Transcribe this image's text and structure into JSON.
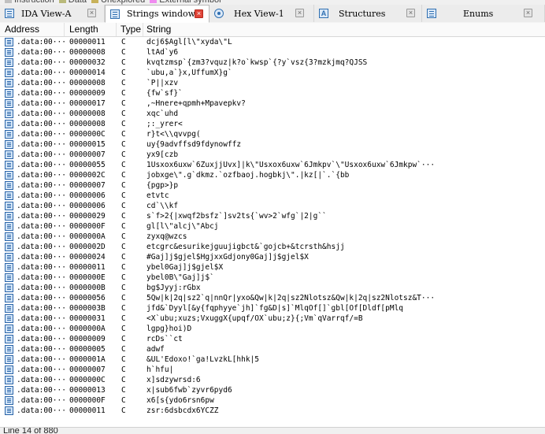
{
  "legend": [
    {
      "label": "Instruction",
      "color": "#c0c0c0"
    },
    {
      "label": "Data",
      "color": "#b9b97a"
    },
    {
      "label": "Unexplored",
      "color": "#c8b25a"
    },
    {
      "label": "External symbol",
      "color": "#f08cf0"
    }
  ],
  "tabs": [
    {
      "label": "IDA View-A",
      "icon": "disassembly-icon",
      "active": false
    },
    {
      "label": "Strings window",
      "icon": "strings-icon",
      "active": true
    },
    {
      "label": "Hex View-1",
      "icon": "hex-view-icon",
      "active": false
    },
    {
      "label": "Structures",
      "icon": "structures-icon",
      "active": false
    },
    {
      "label": "Enums",
      "icon": "enums-icon",
      "active": false
    }
  ],
  "columns": {
    "address": "Address",
    "length": "Length",
    "type": "Type",
    "string": "String"
  },
  "rows": [
    {
      "address": ".data:00···",
      "length": "00000011",
      "type": "C",
      "string": "dcj6$Agl[l\\\"xyda\\\"L"
    },
    {
      "address": ".data:00···",
      "length": "00000008",
      "type": "C",
      "string": "ltAd`y6"
    },
    {
      "address": ".data:00···",
      "length": "00000032",
      "type": "C",
      "string": "kvqtzmsp`{zm3?vquz|k?o`kwsp`{?y`vsz{3?mzkjmq?QJSS"
    },
    {
      "address": ".data:00···",
      "length": "00000014",
      "type": "C",
      "string": "`ubu,a`}x,UffumX}g`"
    },
    {
      "address": ".data:00···",
      "length": "00000008",
      "type": "C",
      "string": "`P||xzv"
    },
    {
      "address": ".data:00···",
      "length": "00000009",
      "type": "C",
      "string": "{fw`sf}`"
    },
    {
      "address": ".data:00···",
      "length": "00000017",
      "type": "C",
      "string": ",~Hnere+qpmh+Mpavepkv?"
    },
    {
      "address": ".data:00···",
      "length": "00000008",
      "type": "C",
      "string": "xqc`uhd"
    },
    {
      "address": ".data:00···",
      "length": "00000008",
      "type": "C",
      "string": ";:_yrer<"
    },
    {
      "address": ".data:00···",
      "length": "0000000C",
      "type": "C",
      "string": "r}t<\\\\qvvpg("
    },
    {
      "address": ".data:00···",
      "length": "00000015",
      "type": "C",
      "string": "uy{9advffsd9fdynowffz"
    },
    {
      "address": ".data:00···",
      "length": "00000007",
      "type": "C",
      "string": "yx9[czb"
    },
    {
      "address": ".data:00···",
      "length": "00000055",
      "type": "C",
      "string": "1Usxox6uxw`6ZuxjjUvx]|k\\\"Usxox6uxw`6Jmkpv`\\\"Usxox6uxw`6Jmkpw`···"
    },
    {
      "address": ".data:00···",
      "length": "0000002C",
      "type": "C",
      "string": "jobxge\\\".g`dkmz.`ozfbaoj.hogbkj\\\".|kz[|`.`{bb"
    },
    {
      "address": ".data:00···",
      "length": "00000007",
      "type": "C",
      "string": "{pgp>}p"
    },
    {
      "address": ".data:00···",
      "length": "00000006",
      "type": "C",
      "string": "etvtc"
    },
    {
      "address": ".data:00···",
      "length": "00000006",
      "type": "C",
      "string": "cd`\\\\kf"
    },
    {
      "address": ".data:00···",
      "length": "00000029",
      "type": "C",
      "string": "s`f>2{|xwqf2bsfz`]sv2ts{`wv>2`wfg`|2|g``"
    },
    {
      "address": ".data:00···",
      "length": "0000000F",
      "type": "C",
      "string": "gl[l\\\"alcj\\\"Abcj"
    },
    {
      "address": ".data:00···",
      "length": "0000000A",
      "type": "C",
      "string": "zyxq@wzcs"
    },
    {
      "address": ".data:00···",
      "length": "0000002D",
      "type": "C",
      "string": "etcgrc&esurikejguujigbct&`gojcb+&tcrsth&hsjj"
    },
    {
      "address": ".data:00···",
      "length": "00000024",
      "type": "C",
      "string": "#Gaj]j$gjel$HgjxxGdjony0Gaj]j$gjel$X"
    },
    {
      "address": ".data:00···",
      "length": "00000011",
      "type": "C",
      "string": "ybel0Gaj]j$gjel$X"
    },
    {
      "address": ".data:00···",
      "length": "0000000E",
      "type": "C",
      "string": "ybel0B\\\"Gaj]j$`"
    },
    {
      "address": ".data:00···",
      "length": "0000000B",
      "type": "C",
      "string": "bg$Jyyj:rGbx"
    },
    {
      "address": ".data:00···",
      "length": "00000056",
      "type": "C",
      "string": "5Qw|k|2q|sz2`q|nnQr|yxo&Qw|k|2q|sz2Nlotsz&Qw|k|2q|sz2Nlotsz&T···"
    },
    {
      "address": ".data:00···",
      "length": "0000003B",
      "type": "C",
      "string": "jfd&`Dyyl[&y{fqphyye`jh]`fg&D|s]`MlqOf[]`gbl[Of[Dldf[pMlq"
    },
    {
      "address": ".data:00···",
      "length": "00000031",
      "type": "C",
      "string": "<X`ubu;xuzs;VxuggX{upqf/OX`ubu;z}{;Vm`qVarrqf/=B"
    },
    {
      "address": ".data:00···",
      "length": "0000000A",
      "type": "C",
      "string": "lgpg}hoi)D"
    },
    {
      "address": ".data:00···",
      "length": "00000009",
      "type": "C",
      "string": "rcDs``ct"
    },
    {
      "address": ".data:00···",
      "length": "00000005",
      "type": "C",
      "string": "adwf"
    },
    {
      "address": ".data:00···",
      "length": "0000001A",
      "type": "C",
      "string": "&UL'Edoxo!`ga!LvzkL[hhk|5"
    },
    {
      "address": ".data:00···",
      "length": "00000007",
      "type": "C",
      "string": "h`hfu|"
    },
    {
      "address": ".data:00···",
      "length": "0000000C",
      "type": "C",
      "string": "x]sdzywrsd:6"
    },
    {
      "address": ".data:00···",
      "length": "00000013",
      "type": "C",
      "string": "x|sub6fwb`zyvr6pyd6"
    },
    {
      "address": ".data:00···",
      "length": "0000000F",
      "type": "C",
      "string": "x6[s{ydo6rsn6pw"
    },
    {
      "address": ".data:00···",
      "length": "00000011",
      "type": "C",
      "string": "zsr:6dsbcdx6YCZZ"
    }
  ],
  "status": "Line 14 of 880"
}
